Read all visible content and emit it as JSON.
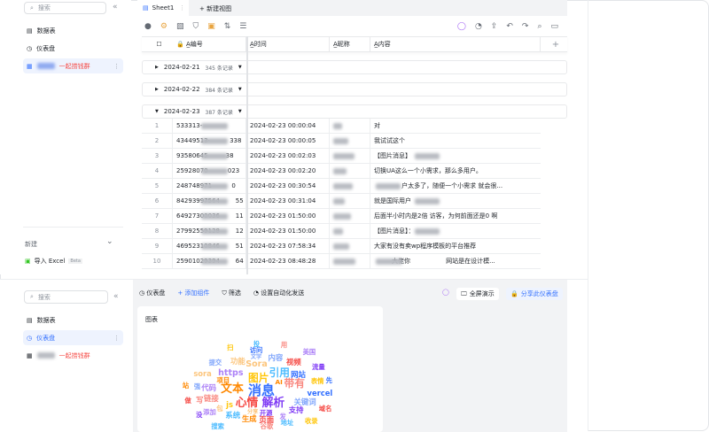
{
  "top": {
    "sidebar": {
      "search_placeholder": "搜索",
      "items": [
        {
          "label": "数据表",
          "icon": "table-icon"
        },
        {
          "label": "仪表盘",
          "icon": "dashboard-icon"
        },
        {
          "label": "一起捞钱群",
          "icon": "sync-table-icon"
        }
      ],
      "new_label": "新建",
      "import_label": "导入 Excel",
      "import_badge": "Beta"
    },
    "tabs": {
      "sheet": "Sheet1",
      "new_view": "+ 新建视图"
    },
    "columns": [
      "编号",
      "时间",
      "昵称",
      "内容"
    ],
    "groups": [
      {
        "date": "2024-02-21",
        "count": "345 条记录"
      },
      {
        "date": "2024-02-22",
        "count": "384 条记录"
      },
      {
        "date": "2024-02-23",
        "count": "387 条记录"
      }
    ],
    "rows": [
      {
        "n": "1",
        "id": "533313-",
        "time": "2024-02-23 00:00:04",
        "content": "对"
      },
      {
        "n": "2",
        "id": "43449513·          338",
        "time": "2024-02-23 00:00:05",
        "content": "我试试这个"
      },
      {
        "n": "3",
        "id": "93580645         38",
        "time": "2024-02-23 00:02:03",
        "content": "【图片消息】"
      },
      {
        "n": "4",
        "id": "25928070          023",
        "time": "2024-02-23 00:02:20",
        "content": "切换UA这么一个小需求，那么多用户。"
      },
      {
        "n": "5",
        "id": "248748971          0",
        "time": "2024-02-23 00:30:54",
        "content": "              户太多了，随便一个小需求 就会很..."
      },
      {
        "n": "6",
        "id": "84293997564        55",
        "time": "2024-02-23 00:31:04",
        "content": "就是国际用户"
      },
      {
        "n": "7",
        "id": "64927300036        11",
        "time": "2024-02-23 01:50:00",
        "content": "后面半小时内是2倍 访客，为何前面还是0 啊"
      },
      {
        "n": "8",
        "id": "27992559128        12",
        "time": "2024-02-23 01:50:00",
        "content": "【图片消息】："
      },
      {
        "n": "9",
        "id": "46952310846        51",
        "time": "2024-02-23 07:58:34",
        "content": "大家有没有卖wp程序模板的平台推荐"
      },
      {
        "n": "10",
        "id": "25901029394        64",
        "time": "2024-02-23 08:48:28",
        "content": "         大佬你                  网站是在设计模..."
      }
    ]
  },
  "bottom": {
    "sidebar": {
      "search_placeholder": "搜索",
      "items": [
        {
          "label": "数据表"
        },
        {
          "label": "仪表盘"
        },
        {
          "label": "一起捞钱群"
        }
      ]
    },
    "toolbar": {
      "title": "仪表盘",
      "add": "+ 添加组件",
      "filter": "筛选",
      "automation": "设置自动化发送",
      "present": "全屏演示",
      "share": "分享此仪表盘"
    },
    "card_title": "图表",
    "accent": "#3370ff",
    "words": [
      [
        "消息",
        10
      ],
      [
        "解析",
        8
      ],
      [
        "心情",
        8
      ],
      [
        "文本",
        8
      ],
      [
        "图片",
        7
      ],
      [
        "引用",
        7
      ],
      [
        "带有",
        7
      ],
      [
        "https",
        5
      ],
      [
        "Sora",
        5
      ],
      [
        "关键词",
        4
      ],
      [
        "网站",
        4
      ],
      [
        "支持",
        4
      ],
      [
        "页面",
        4
      ],
      [
        "生成",
        4
      ],
      [
        "js",
        4
      ],
      [
        "系统",
        4
      ],
      [
        "链接",
        4
      ],
      [
        "代码",
        4
      ],
      [
        "功能",
        4
      ],
      [
        "内容",
        4
      ],
      [
        "vercel",
        4
      ],
      [
        "开源",
        3
      ],
      [
        "视频",
        4
      ],
      [
        "项目",
        3
      ],
      [
        "表情",
        3
      ],
      [
        "地址",
        3
      ],
      [
        "谷歌",
        3
      ],
      [
        "添加",
        3
      ],
      [
        "sora",
        4
      ],
      [
        "提交",
        3
      ],
      [
        "访问",
        3
      ],
      [
        "流量",
        3
      ],
      [
        "域名",
        3
      ],
      [
        "AI",
        3
      ],
      [
        "收录",
        3
      ],
      [
        "搜索",
        3
      ],
      [
        "写",
        4
      ],
      [
        "发",
        3
      ],
      [
        "包",
        3
      ],
      [
        "强",
        3
      ],
      [
        "先",
        3
      ],
      [
        "没",
        3
      ],
      [
        "做",
        3
      ],
      [
        "站",
        3
      ],
      [
        "扫",
        3
      ],
      [
        "投",
        3
      ],
      [
        "用",
        3
      ],
      [
        "美国",
        3
      ],
      [
        "分享",
        2
      ],
      [
        "文字",
        2
      ]
    ],
    "word_colors": [
      "#3370ff",
      "#7f3bf5",
      "#f54a45",
      "#ff8800",
      "#ffc60a",
      "#4ebcff",
      "#f98981",
      "#ad82f7",
      "#fcc57c",
      "#82a7fc"
    ]
  }
}
